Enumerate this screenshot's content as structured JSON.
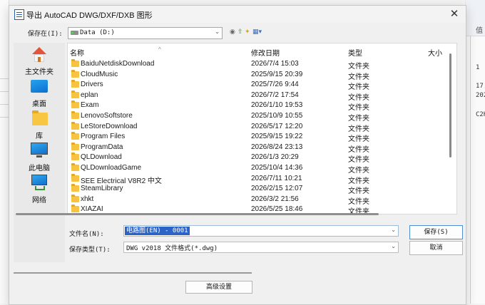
{
  "dialog": {
    "title": "导出 AutoCAD DWG/DXF/DXB 图形",
    "close_glyph": "✕",
    "save_in_label": "保存在(I):",
    "save_in_value": "Data (D:)",
    "toolbar_icons": [
      "back-icon",
      "up-folder-icon",
      "new-folder-icon",
      "view-menu-icon"
    ],
    "places": [
      {
        "label": "主文件夹",
        "icon": "home-icon"
      },
      {
        "label": "桌面",
        "icon": "desktop-icon"
      },
      {
        "label": "库",
        "icon": "library-icon"
      },
      {
        "label": "此电脑",
        "icon": "computer-icon"
      },
      {
        "label": "网络",
        "icon": "network-icon"
      }
    ],
    "columns": {
      "name": "名称",
      "modified": "修改日期",
      "type": "类型",
      "size": "大小"
    },
    "files": [
      {
        "name": "BaiduNetdiskDownload",
        "date": "2026/7/4 15:03",
        "type": "文件夹"
      },
      {
        "name": "CloudMusic",
        "date": "2025/9/15 20:39",
        "type": "文件夹"
      },
      {
        "name": "Drivers",
        "date": "2025/7/26 9:44",
        "type": "文件夹"
      },
      {
        "name": "eplan",
        "date": "2026/7/2 17:54",
        "type": "文件夹"
      },
      {
        "name": "Exam",
        "date": "2026/1/10 19:53",
        "type": "文件夹"
      },
      {
        "name": "LenovoSoftstore",
        "date": "2025/10/9 10:55",
        "type": "文件夹"
      },
      {
        "name": "LeStoreDownload",
        "date": "2026/5/17 12:20",
        "type": "文件夹"
      },
      {
        "name": "Program Files",
        "date": "2025/9/15 19:22",
        "type": "文件夹"
      },
      {
        "name": "ProgramData",
        "date": "2026/8/24 23:13",
        "type": "文件夹"
      },
      {
        "name": "QLDownload",
        "date": "2026/1/3 20:29",
        "type": "文件夹"
      },
      {
        "name": "QLDownloadGame",
        "date": "2025/10/4 14:36",
        "type": "文件夹"
      },
      {
        "name": "SEE Electrical V8R2 中文",
        "date": "2026/7/11 10:21",
        "type": "文件夹"
      },
      {
        "name": "SteamLibrary",
        "date": "2026/2/15 12:07",
        "type": "文件夹"
      },
      {
        "name": "xhkt",
        "date": "2026/3/2 21:56",
        "type": "文件夹"
      },
      {
        "name": "XIAZAI",
        "date": "2026/5/25 18:46",
        "type": "文件夹"
      }
    ],
    "filename_label": "文件名(N):",
    "filename_value": "电路图(EN) - 0001",
    "filetype_label": "保存类型(T):",
    "filetype_value": "DWG v2018 文件格式(*.dwg)",
    "save_button": "保存(S)",
    "cancel_button": "取消",
    "advanced_button": "高级设置"
  },
  "background": {
    "header_label": "值",
    "values": [
      "1",
      "17.",
      "202",
      "C2H"
    ]
  }
}
